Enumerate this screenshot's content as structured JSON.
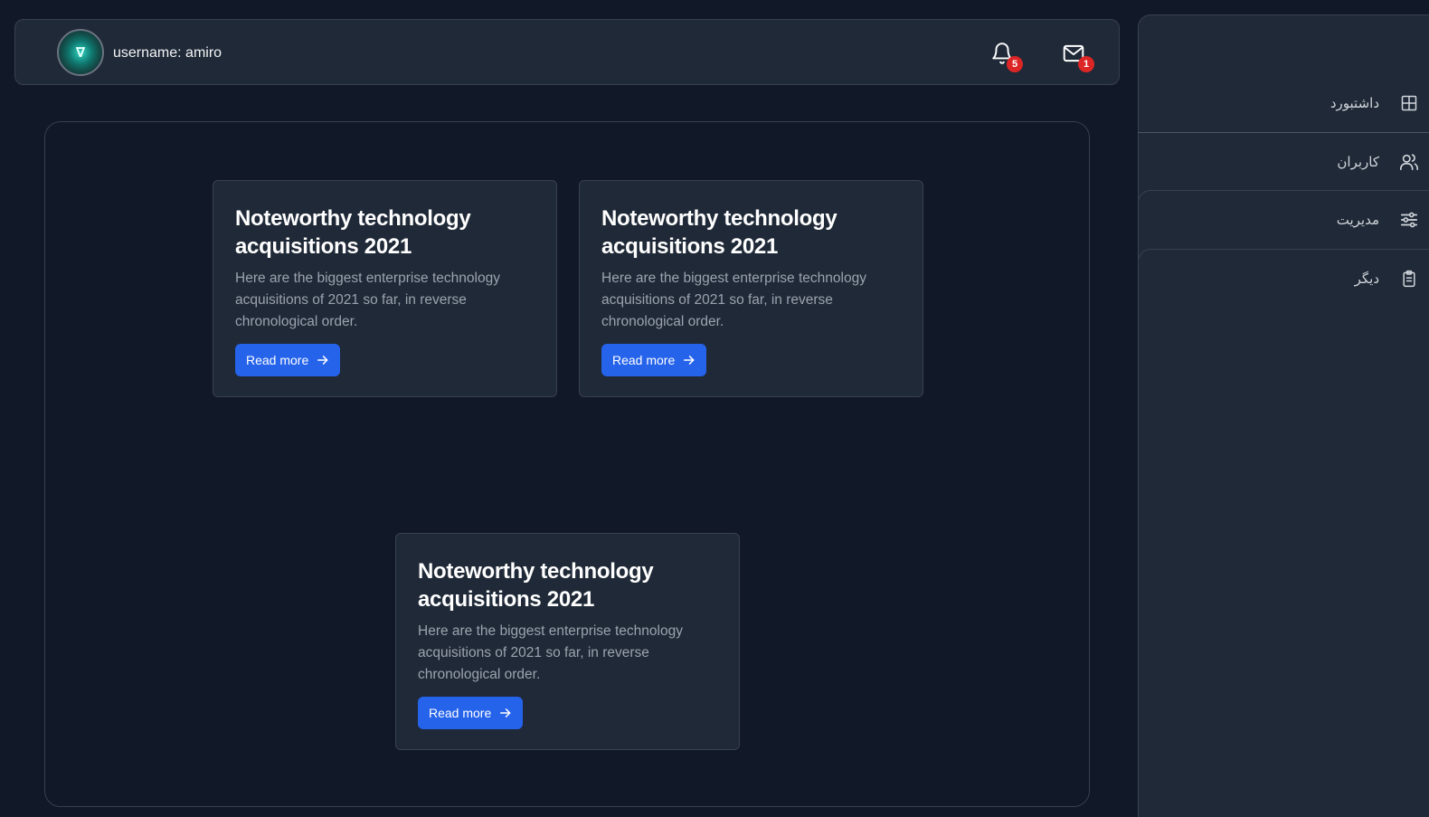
{
  "header": {
    "avatar_glyph": "∇",
    "username": "username: amiro",
    "notifications_count": "5",
    "messages_count": "1",
    "icons": {
      "notifications": "bell-icon",
      "messages": "mail-icon"
    }
  },
  "sidebar": {
    "items": [
      {
        "label": "داشتبورد",
        "icon": "grid-icon"
      },
      {
        "label": "کاربران",
        "icon": "users-icon"
      },
      {
        "label": "مدیریت",
        "icon": "sliders-icon"
      },
      {
        "label": "دیگر",
        "icon": "clipboard-icon"
      }
    ]
  },
  "cards": [
    {
      "title": "Noteworthy technology acquisitions 2021",
      "text": "Here are the biggest enterprise technology acquisitions of 2021 so far, in reverse chronological order.",
      "button": "Read more"
    },
    {
      "title": "Noteworthy technology acquisitions 2021",
      "text": "Here are the biggest enterprise technology acquisitions of 2021 so far, in reverse chronological order.",
      "button": "Read more"
    },
    {
      "title": "Noteworthy technology acquisitions 2021",
      "text": "Here are the biggest enterprise technology acquisitions of 2021 so far, in reverse chronological order.",
      "button": "Read more"
    }
  ],
  "colors": {
    "background": "#111827",
    "surface": "#1f2937",
    "border": "#374151",
    "primary_button": "#2563eb",
    "badge": "#dc2626",
    "muted_text": "#9ca3af"
  }
}
